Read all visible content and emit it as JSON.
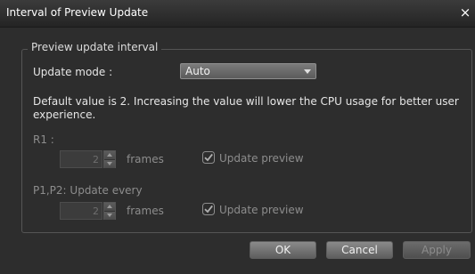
{
  "window": {
    "title": "Interval of Preview Update",
    "close_glyph": "×"
  },
  "group": {
    "legend": "Preview update interval"
  },
  "update_mode": {
    "label": "Update mode :",
    "value": "Auto"
  },
  "description": "Default value is 2. Increasing the value will lower the CPU usage for better user experience.",
  "r1": {
    "label": "R1 :",
    "value": "2",
    "unit": "frames",
    "checkbox_label": "Update preview",
    "checked": true
  },
  "p1p2": {
    "label": "P1,P2: Update every",
    "value": "2",
    "unit": "frames",
    "checkbox_label": "Update preview",
    "checked": true
  },
  "buttons": {
    "ok": "OK",
    "cancel": "Cancel",
    "apply": "Apply"
  },
  "icons": {
    "close": "close-icon",
    "dropdown": "chevron-down-icon",
    "spin_up": "spin-up-icon",
    "spin_down": "spin-down-icon",
    "check": "checkbox-checked-icon"
  },
  "colors": {
    "background": "#2d2d2d",
    "text": "#e6e6e6",
    "disabled_text": "#8d8d8d"
  }
}
